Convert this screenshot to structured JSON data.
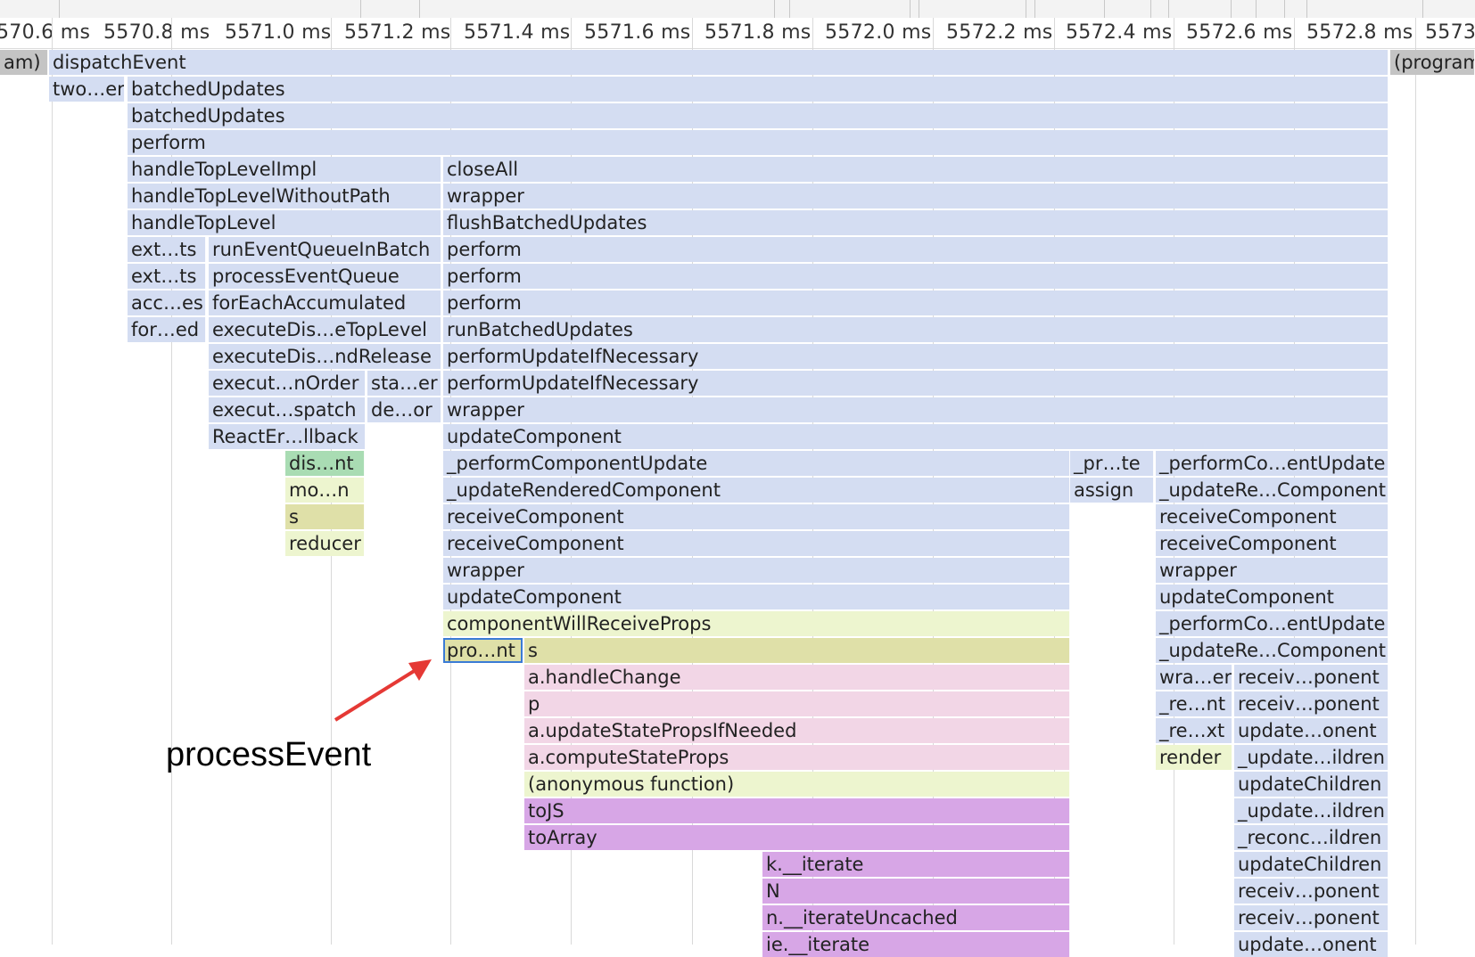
{
  "ruler": {
    "ticks": [
      "570.6 ms",
      "5570.8 ms",
      "5571.0 ms",
      "5571.2 ms",
      "5571.4 ms",
      "5571.6 ms",
      "5571.8 ms",
      "5572.0 ms",
      "5572.2 ms",
      "5572.4 ms",
      "5572.6 ms",
      "5572.8 ms",
      "5573"
    ]
  },
  "colors": {
    "blue": "#d4ddf2",
    "green": "#a9dcb3",
    "yellow_light": "#edf5cf",
    "olive": "#dfe0a8",
    "pink": "#f2d6e6",
    "purple": "#d7a6e6",
    "grey": "#c4c4c4",
    "selection": "#3a7bd5",
    "arrow": "#e53935"
  },
  "annotation": {
    "text": "processEvent",
    "arrow_icon": "red-arrow"
  },
  "flame": [
    {
      "row": 0,
      "label": "am)",
      "color": "grey"
    },
    {
      "row": 0,
      "label": "dispatchEvent",
      "color": "blue"
    },
    {
      "row": 0,
      "label": "(program",
      "color": "grey"
    },
    {
      "row": 1,
      "label": "two…er",
      "color": "blue"
    },
    {
      "row": 1,
      "label": "batchedUpdates",
      "color": "blue"
    },
    {
      "row": 2,
      "label": "batchedUpdates",
      "color": "blue"
    },
    {
      "row": 3,
      "label": "perform",
      "color": "blue"
    },
    {
      "row": 4,
      "label": "handleTopLevelImpl",
      "color": "blue"
    },
    {
      "row": 4,
      "label": "closeAll",
      "color": "blue"
    },
    {
      "row": 5,
      "label": "handleTopLevelWithoutPath",
      "color": "blue"
    },
    {
      "row": 5,
      "label": "wrapper",
      "color": "blue"
    },
    {
      "row": 6,
      "label": "handleTopLevel",
      "color": "blue"
    },
    {
      "row": 6,
      "label": "flushBatchedUpdates",
      "color": "blue"
    },
    {
      "row": 7,
      "label": "ext…ts",
      "color": "blue"
    },
    {
      "row": 7,
      "label": "runEventQueueInBatch",
      "color": "blue"
    },
    {
      "row": 7,
      "label": "perform",
      "color": "blue"
    },
    {
      "row": 8,
      "label": "ext…ts",
      "color": "blue"
    },
    {
      "row": 8,
      "label": "processEventQueue",
      "color": "blue"
    },
    {
      "row": 8,
      "label": "perform",
      "color": "blue"
    },
    {
      "row": 9,
      "label": "acc…es",
      "color": "blue"
    },
    {
      "row": 9,
      "label": "forEachAccumulated",
      "color": "blue"
    },
    {
      "row": 9,
      "label": "perform",
      "color": "blue"
    },
    {
      "row": 10,
      "label": "for…ed",
      "color": "blue"
    },
    {
      "row": 10,
      "label": "executeDis…eTopLevel",
      "color": "blue"
    },
    {
      "row": 10,
      "label": "runBatchedUpdates",
      "color": "blue"
    },
    {
      "row": 11,
      "label": "executeDis…ndRelease",
      "color": "blue"
    },
    {
      "row": 11,
      "label": "performUpdateIfNecessary",
      "color": "blue"
    },
    {
      "row": 12,
      "label": "execut…nOrder",
      "color": "blue"
    },
    {
      "row": 12,
      "label": "sta…er",
      "color": "blue"
    },
    {
      "row": 12,
      "label": "performUpdateIfNecessary",
      "color": "blue"
    },
    {
      "row": 13,
      "label": "execut…spatch",
      "color": "blue"
    },
    {
      "row": 13,
      "label": "de…or",
      "color": "blue"
    },
    {
      "row": 13,
      "label": "wrapper",
      "color": "blue"
    },
    {
      "row": 14,
      "label": "ReactEr…llback",
      "color": "blue"
    },
    {
      "row": 14,
      "label": "updateComponent",
      "color": "blue"
    },
    {
      "row": 15,
      "label": "dis…nt",
      "color": "green"
    },
    {
      "row": 15,
      "label": "_performComponentUpdate",
      "color": "blue"
    },
    {
      "row": 15,
      "label": "_pr…te",
      "color": "blue"
    },
    {
      "row": 15,
      "label": "_performCo…entUpdate",
      "color": "blue"
    },
    {
      "row": 16,
      "label": "mo…n",
      "color": "ylight"
    },
    {
      "row": 16,
      "label": "_updateRenderedComponent",
      "color": "blue"
    },
    {
      "row": 16,
      "label": "assign",
      "color": "blue"
    },
    {
      "row": 16,
      "label": "_updateRe…Component",
      "color": "blue"
    },
    {
      "row": 17,
      "label": "s",
      "color": "olive"
    },
    {
      "row": 17,
      "label": "receiveComponent",
      "color": "blue"
    },
    {
      "row": 17,
      "label": "receiveComponent",
      "color": "blue"
    },
    {
      "row": 18,
      "label": "reducer",
      "color": "ylight"
    },
    {
      "row": 18,
      "label": "receiveComponent",
      "color": "blue"
    },
    {
      "row": 18,
      "label": "receiveComponent",
      "color": "blue"
    },
    {
      "row": 19,
      "label": "wrapper",
      "color": "blue"
    },
    {
      "row": 19,
      "label": "wrapper",
      "color": "blue"
    },
    {
      "row": 20,
      "label": "updateComponent",
      "color": "blue"
    },
    {
      "row": 20,
      "label": "updateComponent",
      "color": "blue"
    },
    {
      "row": 21,
      "label": "componentWillReceiveProps",
      "color": "ylight"
    },
    {
      "row": 21,
      "label": "_performCo…entUpdate",
      "color": "blue"
    },
    {
      "row": 22,
      "label": "pro…nt",
      "color": "olive",
      "selected": true
    },
    {
      "row": 22,
      "label": "s",
      "color": "olive"
    },
    {
      "row": 22,
      "label": "_updateRe…Component",
      "color": "blue"
    },
    {
      "row": 23,
      "label": "a.handleChange",
      "color": "pink"
    },
    {
      "row": 23,
      "label": "wra…er",
      "color": "blue"
    },
    {
      "row": 23,
      "label": "receiv…ponent",
      "color": "blue"
    },
    {
      "row": 24,
      "label": "p",
      "color": "pink"
    },
    {
      "row": 24,
      "label": "_re…nt",
      "color": "blue"
    },
    {
      "row": 24,
      "label": "receiv…ponent",
      "color": "blue"
    },
    {
      "row": 25,
      "label": "a.updateStatePropsIfNeeded",
      "color": "pink"
    },
    {
      "row": 25,
      "label": "_re…xt",
      "color": "blue"
    },
    {
      "row": 25,
      "label": "update…onent",
      "color": "blue"
    },
    {
      "row": 26,
      "label": "a.computeStateProps",
      "color": "pink"
    },
    {
      "row": 26,
      "label": "render",
      "color": "ylight"
    },
    {
      "row": 26,
      "label": "_update…ildren",
      "color": "blue"
    },
    {
      "row": 27,
      "label": "(anonymous function)",
      "color": "ylight"
    },
    {
      "row": 27,
      "label": "updateChildren",
      "color": "blue"
    },
    {
      "row": 28,
      "label": "toJS",
      "color": "purple"
    },
    {
      "row": 28,
      "label": "_update…ildren",
      "color": "blue"
    },
    {
      "row": 29,
      "label": "toArray",
      "color": "purple"
    },
    {
      "row": 29,
      "label": "_reconc…ildren",
      "color": "blue"
    },
    {
      "row": 30,
      "label": "k.__iterate",
      "color": "purple"
    },
    {
      "row": 30,
      "label": "updateChildren",
      "color": "blue"
    },
    {
      "row": 31,
      "label": "N",
      "color": "purple"
    },
    {
      "row": 31,
      "label": "receiv…ponent",
      "color": "blue"
    },
    {
      "row": 32,
      "label": "n.__iterateUncached",
      "color": "purple"
    },
    {
      "row": 32,
      "label": "receiv…ponent",
      "color": "blue"
    },
    {
      "row": 33,
      "label": "ie.__iterate",
      "color": "purple"
    },
    {
      "row": 33,
      "label": "update…onent",
      "color": "blue"
    }
  ]
}
